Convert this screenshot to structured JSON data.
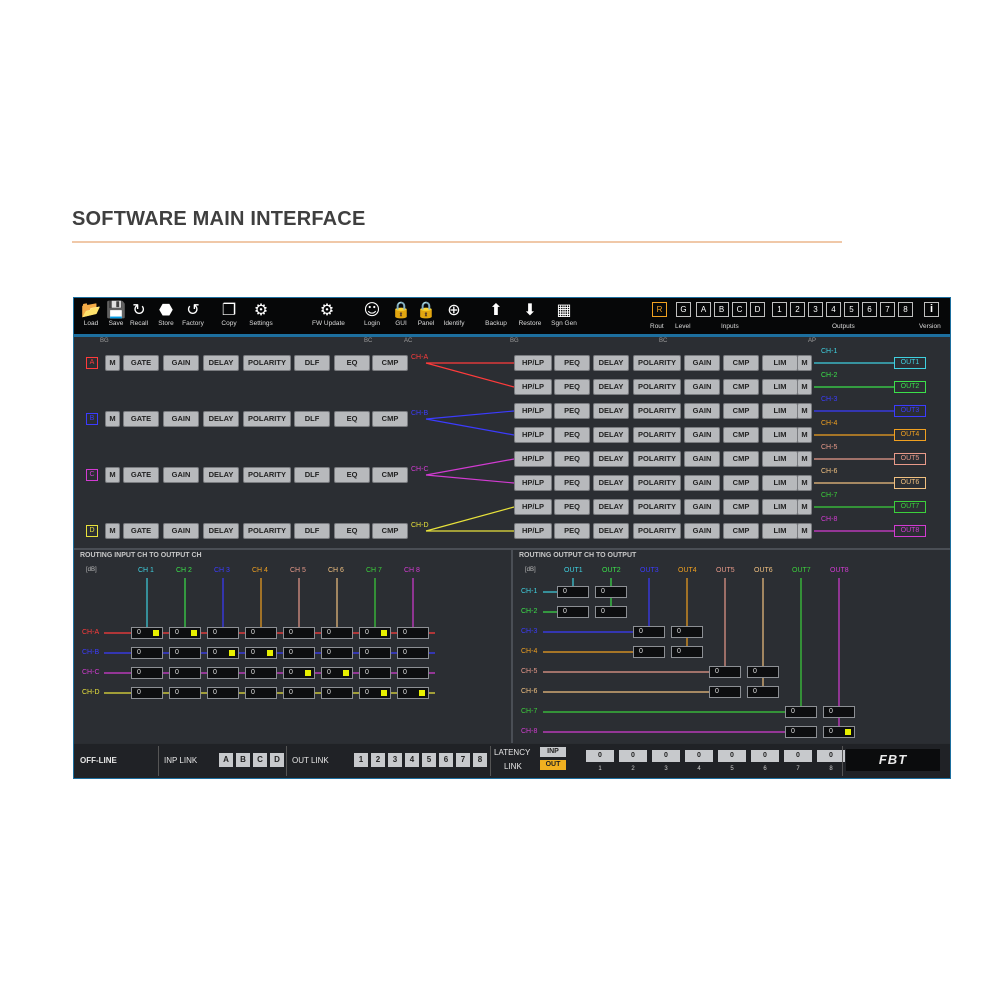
{
  "page": {
    "title": "SOFTWARE MAIN INTERFACE"
  },
  "toolbar": {
    "tools": [
      {
        "label": "Load",
        "icon": "folder-icon"
      },
      {
        "label": "Save",
        "icon": "save-icon"
      },
      {
        "label": "Recall",
        "icon": "recall-icon"
      },
      {
        "label": "Store",
        "icon": "store-icon"
      },
      {
        "label": "Factory",
        "icon": "factory-icon"
      },
      {
        "label": "Copy",
        "icon": "copy-icon"
      },
      {
        "label": "Settings",
        "icon": "gear-icon"
      },
      {
        "label": "FW Update",
        "icon": "fw-update-icon"
      },
      {
        "label": "Login",
        "icon": "login-icon"
      },
      {
        "label": "GUI",
        "icon": "lock-icon"
      },
      {
        "label": "Panel",
        "icon": "lock-icon"
      },
      {
        "label": "Identify",
        "icon": "identify-icon"
      },
      {
        "label": "Backup",
        "icon": "backup-icon"
      },
      {
        "label": "Restore",
        "icon": "restore-icon"
      },
      {
        "label": "Sgn Gen",
        "icon": "signal-generator-icon"
      }
    ],
    "rout_label": "Rout",
    "level_label": "Level",
    "inputs_label": "Inputs",
    "outputs_label": "Outputs",
    "version_label": "Version",
    "rout_btn": "R",
    "level_btn": "G",
    "input_btns": [
      "A",
      "B",
      "C",
      "D"
    ],
    "output_btns": [
      "1",
      "2",
      "3",
      "4",
      "5",
      "6",
      "7",
      "8"
    ],
    "version_icon": "info-icon"
  },
  "processing": {
    "markers": {
      "bg1": "BG",
      "bc1": "BC",
      "ac": "AC",
      "bg2": "BG",
      "bc2": "BC",
      "ap": "AP"
    },
    "input_chain": [
      "M",
      "GATE",
      "GAIN",
      "DELAY",
      "POLARITY",
      "DLF",
      "EQ",
      "CMP"
    ],
    "output_chain": [
      "HP/LP",
      "PEQ",
      "DELAY",
      "POLARITY",
      "GAIN",
      "CMP",
      "LIM",
      "M"
    ],
    "inputs": [
      {
        "btn": "A",
        "ch": "CH-A",
        "color": "#ff3b3b"
      },
      {
        "btn": "B",
        "ch": "CH-B",
        "color": "#3b3bff"
      },
      {
        "btn": "C",
        "ch": "CH-C",
        "color": "#d23bd2"
      },
      {
        "btn": "D",
        "ch": "CH-D",
        "color": "#e8e23b"
      }
    ],
    "outputs": [
      {
        "ch": "CH-1",
        "out": "OUT1",
        "color": "#3fd0e0"
      },
      {
        "ch": "CH-2",
        "out": "OUT2",
        "color": "#3be04a"
      },
      {
        "ch": "CH-3",
        "out": "OUT3",
        "color": "#3b3bff"
      },
      {
        "ch": "CH-4",
        "out": "OUT4",
        "color": "#f0a020"
      },
      {
        "ch": "CH-5",
        "out": "OUT5",
        "color": "#e89a8a"
      },
      {
        "ch": "CH-6",
        "out": "OUT6",
        "color": "#f0c080"
      },
      {
        "ch": "CH-7",
        "out": "OUT7",
        "color": "#3bd03b"
      },
      {
        "ch": "CH-8",
        "out": "OUT8",
        "color": "#d23bd2"
      }
    ]
  },
  "routing_in": {
    "title": "ROUTING INPUT CH TO OUTPUT CH",
    "unit": "[dB]",
    "cols": [
      "CH 1",
      "CH 2",
      "CH 3",
      "CH 4",
      "CH 5",
      "CH 6",
      "CH 7",
      "CH 8"
    ],
    "col_colors": [
      "#3fd0e0",
      "#3be04a",
      "#3b3bff",
      "#f0a020",
      "#e89a8a",
      "#f0c080",
      "#3bd03b",
      "#d23bd2"
    ],
    "rows": [
      "CH-A",
      "CH-B",
      "CH-C",
      "CH-D"
    ],
    "row_colors": [
      "#ff3b3b",
      "#3b3bff",
      "#d23bd2",
      "#e8e23b"
    ],
    "values": [
      [
        "0",
        "0",
        "0",
        "0",
        "0",
        "0",
        "0",
        "0"
      ],
      [
        "0",
        "0",
        "0",
        "0",
        "0",
        "0",
        "0",
        "0"
      ],
      [
        "0",
        "0",
        "0",
        "0",
        "0",
        "0",
        "0",
        "0"
      ],
      [
        "0",
        "0",
        "0",
        "0",
        "0",
        "0",
        "0",
        "0"
      ]
    ],
    "active": [
      [
        1,
        1,
        0,
        0,
        0,
        0,
        1,
        0
      ],
      [
        0,
        0,
        1,
        1,
        0,
        0,
        0,
        0
      ],
      [
        0,
        0,
        0,
        0,
        1,
        1,
        0,
        0
      ],
      [
        0,
        0,
        0,
        0,
        0,
        0,
        1,
        1
      ]
    ]
  },
  "routing_out": {
    "title": "ROUTING OUTPUT CH TO OUTPUT",
    "unit": "[dB]",
    "cols": [
      "OUT1",
      "OUT2",
      "OUT3",
      "OUT4",
      "OUT5",
      "OUT6",
      "OUT7",
      "OUT8"
    ],
    "col_colors": [
      "#3fd0e0",
      "#3be04a",
      "#3b3bff",
      "#f0a020",
      "#e89a8a",
      "#f0c080",
      "#3bd03b",
      "#d23bd2"
    ],
    "rows": [
      "CH-1",
      "CH-2",
      "CH-3",
      "CH-4",
      "CH-5",
      "CH-6",
      "CH-7",
      "CH-8"
    ],
    "row_colors": [
      "#3fd0e0",
      "#3be04a",
      "#3b3bff",
      "#f0a020",
      "#e89a8a",
      "#f0c080",
      "#3bd03b",
      "#d23bd2"
    ],
    "values": [
      "0",
      "0",
      "0",
      "0",
      "0",
      "0",
      "0",
      "0"
    ],
    "active": [
      0,
      0,
      0,
      0,
      0,
      0,
      0,
      1
    ]
  },
  "status": {
    "state": "OFF-LINE",
    "inp_link_label": "INP LINK",
    "inp_link_btns": [
      "A",
      "B",
      "C",
      "D"
    ],
    "out_link_label": "OUT LINK",
    "out_link_btns": [
      "1",
      "2",
      "3",
      "4",
      "5",
      "6",
      "7",
      "8"
    ],
    "latency_link_label1": "LATENCY",
    "latency_link_label2": "LINK",
    "inp_btn": "INP",
    "out_btn": "OUT",
    "latency_values": [
      "0",
      "0",
      "0",
      "0",
      "0",
      "0",
      "0",
      "0"
    ],
    "latency_nums": [
      "1",
      "2",
      "3",
      "4",
      "5",
      "6",
      "7",
      "8"
    ],
    "logo": "FBT"
  }
}
